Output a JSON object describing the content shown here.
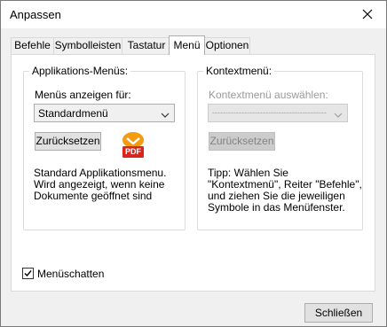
{
  "window": {
    "title": "Anpassen"
  },
  "tabs": [
    "Befehle",
    "Symbolleisten",
    "Tastatur",
    "Menü",
    "Optionen"
  ],
  "active_tab": "Menü",
  "app_menus": {
    "group_label": "Applikations-Menüs:",
    "show_for_label": "Menüs anzeigen für:",
    "selected": "Standardmenü",
    "reset_button": "Zurücksetzen",
    "pdf_badge": "PDF",
    "description": [
      "Standard Applikationsmenu.",
      "Wird angezeigt, wenn keine",
      "Dokumente geöffnet sind"
    ]
  },
  "context_menu": {
    "group_label": "Kontextmenü:",
    "select_label": "Kontextmenü auswählen:",
    "selected": "-------------------------------------------",
    "reset_button": "Zurücksetzen",
    "tip": [
      "Tipp: Wählen Sie",
      "\"Kontextmenü\", Reiter \"Befehle\",",
      "und ziehen Sie die jeweiligen",
      "Symbole in das Menüfenster."
    ]
  },
  "menu_shadow": {
    "label": "Menüschatten",
    "checked": true
  },
  "close_button": "Schließen",
  "colors": {
    "accent": "#0078d7",
    "pdf_orange": "#f39c12",
    "pdf_red": "#d9241c"
  }
}
